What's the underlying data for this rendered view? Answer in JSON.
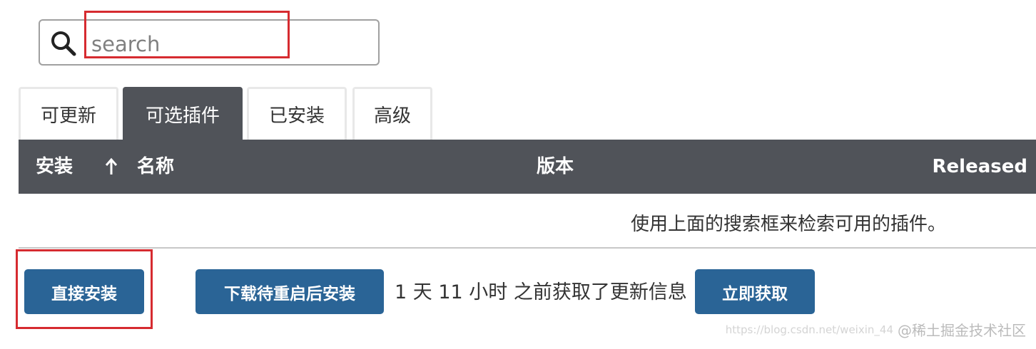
{
  "search": {
    "placeholder": "search",
    "value": ""
  },
  "tabs": [
    {
      "label": "可更新",
      "active": false
    },
    {
      "label": "可选插件",
      "active": true
    },
    {
      "label": "已安装",
      "active": false
    },
    {
      "label": "高级",
      "active": false
    }
  ],
  "table": {
    "columns": {
      "install": "安装",
      "name": "名称",
      "version": "版本",
      "released": "Released"
    },
    "sort_icon": "arrow-up-icon",
    "empty_message": "使用上面的搜索框来检索可用的插件。"
  },
  "actions": {
    "install_now": "直接安装",
    "download_install_after_restart": "下载待重启后安装",
    "update_info": "1 天 11 小时 之前获取了更新信息",
    "check_now": "立即获取"
  },
  "watermark": {
    "text": "@稀土掘金技术社区",
    "url": "https://blog.csdn.net/weixin_44"
  },
  "colors": {
    "header_bg": "#505359",
    "button_bg": "#2a6496",
    "highlight": "#d62b30"
  }
}
